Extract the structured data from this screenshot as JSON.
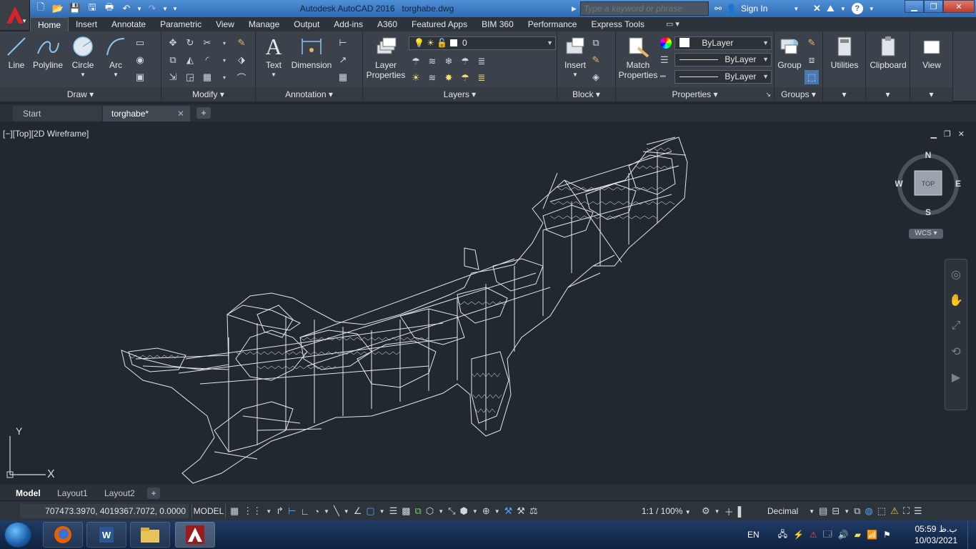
{
  "titlebar": {
    "app_name": "Autodesk AutoCAD 2016",
    "file_name": "torghabe.dwg",
    "search_placeholder": "Type a keyword or phrase",
    "sign_in": "Sign In"
  },
  "ribbon": {
    "tabs": [
      "Home",
      "Insert",
      "Annotate",
      "Parametric",
      "View",
      "Manage",
      "Output",
      "Add-ins",
      "A360",
      "Featured Apps",
      "BIM 360",
      "Performance",
      "Express Tools"
    ],
    "active_tab": "Home",
    "draw": {
      "title": "Draw",
      "line": "Line",
      "polyline": "Polyline",
      "circle": "Circle",
      "arc": "Arc"
    },
    "modify": {
      "title": "Modify"
    },
    "annotation": {
      "title": "Annotation",
      "text": "Text",
      "dimension": "Dimension"
    },
    "layers": {
      "title": "Layers",
      "layer_properties_1": "Layer",
      "layer_properties_2": "Properties",
      "current_layer": "0"
    },
    "block": {
      "title": "Block",
      "insert": "Insert"
    },
    "properties": {
      "title": "Properties",
      "match_1": "Match",
      "match_2": "Properties",
      "color": "ByLayer",
      "linetype": "ByLayer",
      "lineweight": "ByLayer"
    },
    "groups": {
      "title": "Groups",
      "group": "Group"
    },
    "utilities": "Utilities",
    "clipboard": "Clipboard",
    "view": "View"
  },
  "file_tabs": {
    "start": "Start",
    "drawing": "torghabe*"
  },
  "viewport": {
    "label": "[−][Top][2D Wireframe]",
    "cube": {
      "top": "TOP",
      "n": "N",
      "s": "S",
      "e": "E",
      "w": "W"
    },
    "wcs": "WCS",
    "ucs_x": "X",
    "ucs_y": "Y"
  },
  "layout_tabs": [
    "Model",
    "Layout1",
    "Layout2"
  ],
  "statusbar": {
    "coords": "707473.3970, 4019367.7072, 0.0000",
    "model": "MODEL",
    "scale": "1:1 / 100%",
    "units": "Decimal"
  },
  "taskbar": {
    "lang": "EN",
    "time": "05:59 ب.ظ",
    "date": "10/03/2021"
  },
  "colors": {
    "canvas": "#212830",
    "linework": "#e6e6e6",
    "ribbon": "#3b424b",
    "titlebar": "#2f6bb4"
  }
}
